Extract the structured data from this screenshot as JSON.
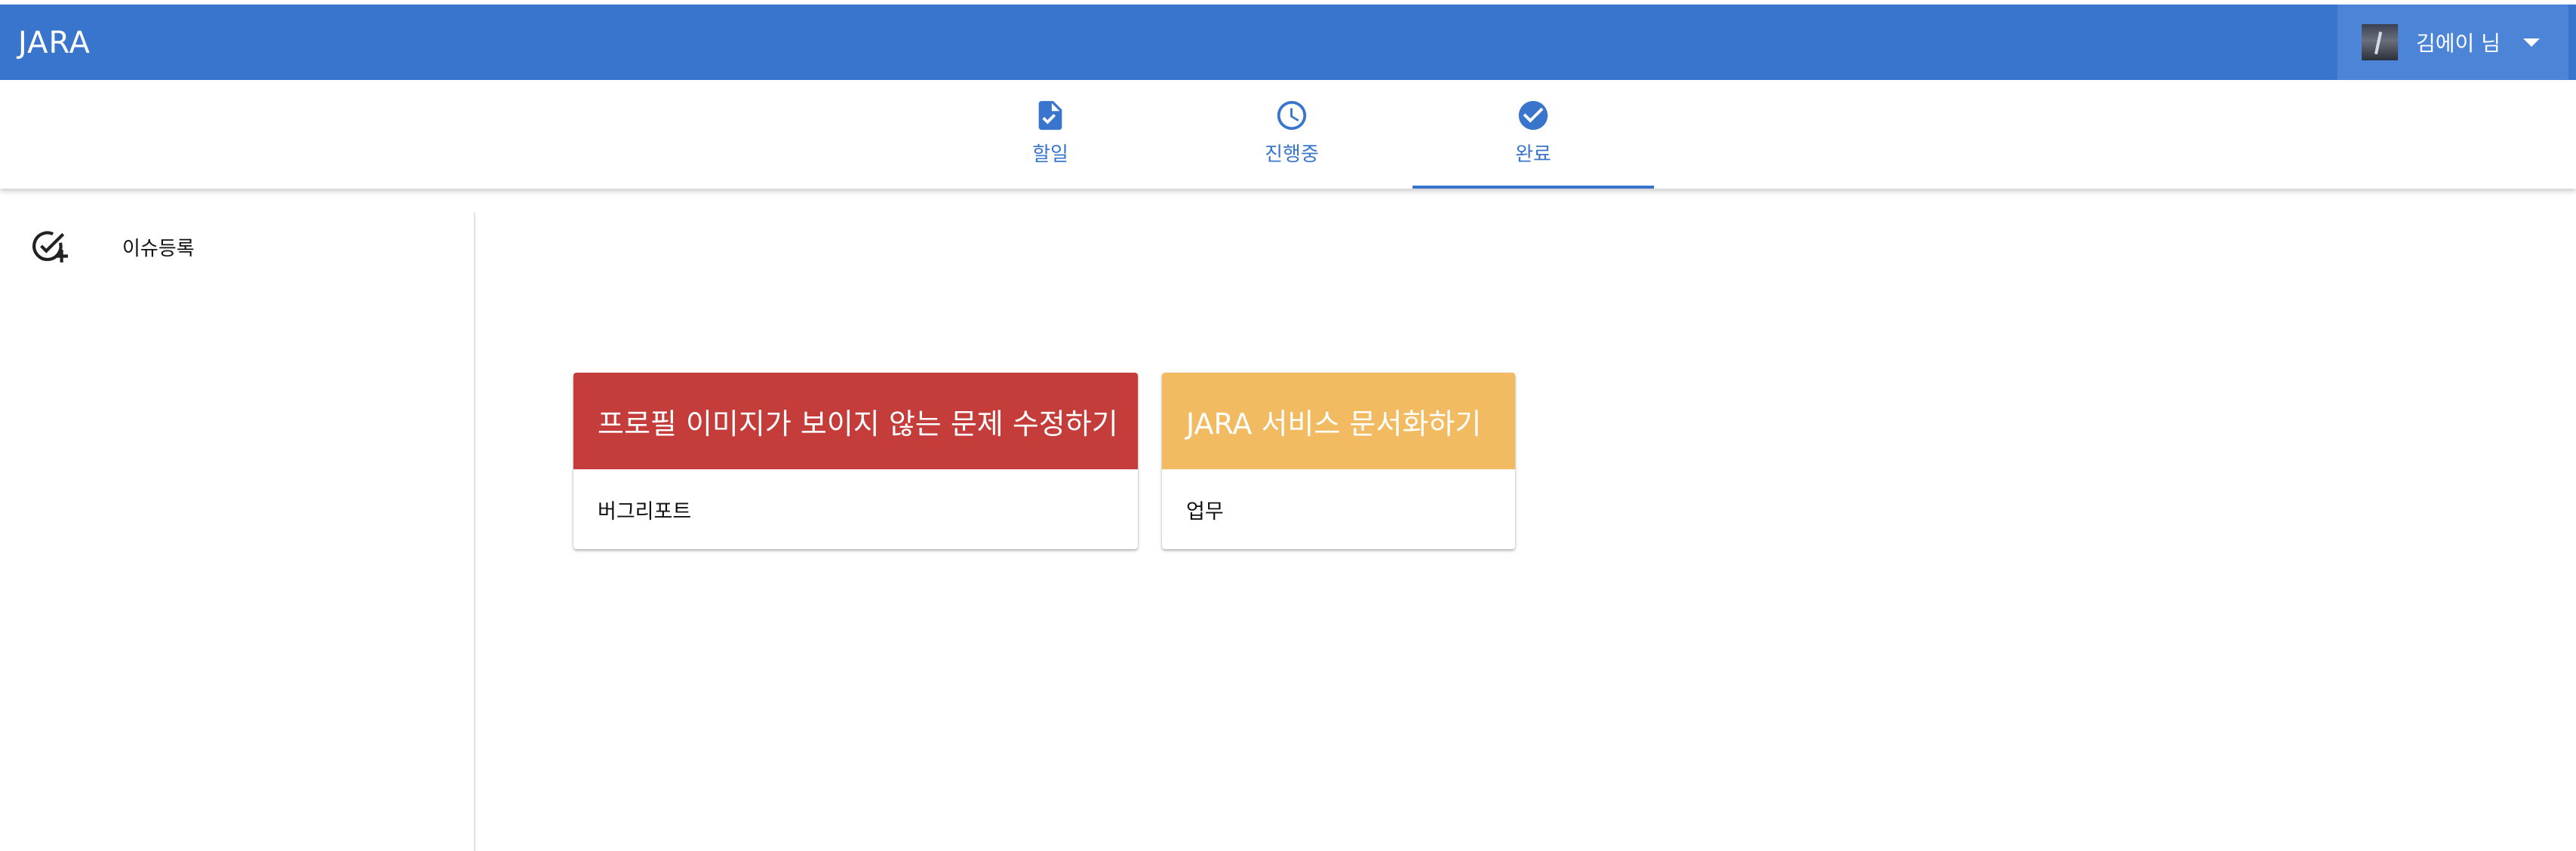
{
  "appbar": {
    "brand": "JARA",
    "user": {
      "name": "김에이 님",
      "avatar_icon": "profile-photo"
    },
    "color": "#3a75cd"
  },
  "tabs": [
    {
      "label": "할일",
      "icon": "document-check-icon",
      "active": false
    },
    {
      "label": "진행중",
      "icon": "clock-icon",
      "active": false
    },
    {
      "label": "완료",
      "icon": "check-circle-icon",
      "active": true
    }
  ],
  "sidebar": {
    "items": [
      {
        "label": "이슈등록",
        "icon": "add-task-icon"
      }
    ]
  },
  "cards": [
    {
      "title": "프로필 이미지가 보이지 않는 문제 수정하기",
      "category": "버그리포트",
      "color": "#c43d3a"
    },
    {
      "title": "JARA 서비스 문서화하기",
      "category": "업무",
      "color": "#f2bb62"
    }
  ]
}
